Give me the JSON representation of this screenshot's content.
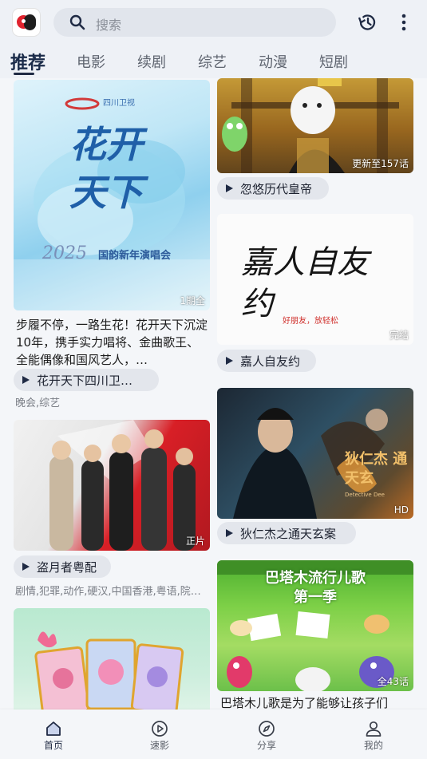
{
  "header": {
    "search_placeholder": "搜索",
    "icons": [
      "app-logo-icon",
      "search-icon",
      "history-icon",
      "more-vertical-icon"
    ]
  },
  "tabs": [
    {
      "label": "推荐",
      "active": true
    },
    {
      "label": "电影",
      "active": false
    },
    {
      "label": "续剧",
      "active": false
    },
    {
      "label": "综艺",
      "active": false
    },
    {
      "label": "动漫",
      "active": false
    },
    {
      "label": "短剧",
      "active": false
    }
  ],
  "feed": {
    "left": [
      {
        "poster_text": {
          "brand": "四川卫视",
          "title1": "花开",
          "title2": "天下",
          "year": "2025",
          "subtitle": "国韵新年演唱会"
        },
        "badge": "1期全",
        "description": "步履不停，一路生花！花开天下沉淀10年，携手实力唱将、金曲歌王、全能偶像和国风艺人，…",
        "title": "花开天下四川卫…",
        "tags": "晚会,综艺"
      },
      {
        "badge": "正片",
        "title": "盗月者粤配",
        "tags": "剧情,犯罪,动作,硬汉,中国香港,粤语,院…"
      },
      {
        "badge": ""
      }
    ],
    "right": [
      {
        "badge": "更新至157话",
        "title": "忽悠历代皇帝"
      },
      {
        "poster_text": {
          "calligraphy": "嘉人自友约",
          "slogan": "好朋友，放轻松"
        },
        "badge": "完结",
        "title": "嘉人自友约"
      },
      {
        "poster_text": {
          "cn": "狄仁杰 通天玄",
          "en": "Detective Dee"
        },
        "badge": "HD",
        "title": "狄仁杰之通天玄案"
      },
      {
        "poster_text": {
          "line1": "巴塔木流行儿歌",
          "line2": "第一季"
        },
        "badge": "全43话",
        "description": "巴塔木儿歌是为了能够让孩子们"
      }
    ]
  },
  "bottom_nav": [
    {
      "label": "首页",
      "icon": "home-icon",
      "active": true
    },
    {
      "label": "速影",
      "icon": "play-circle-icon",
      "active": false
    },
    {
      "label": "分享",
      "icon": "compass-icon",
      "active": false
    },
    {
      "label": "我的",
      "icon": "profile-icon",
      "active": false
    }
  ]
}
